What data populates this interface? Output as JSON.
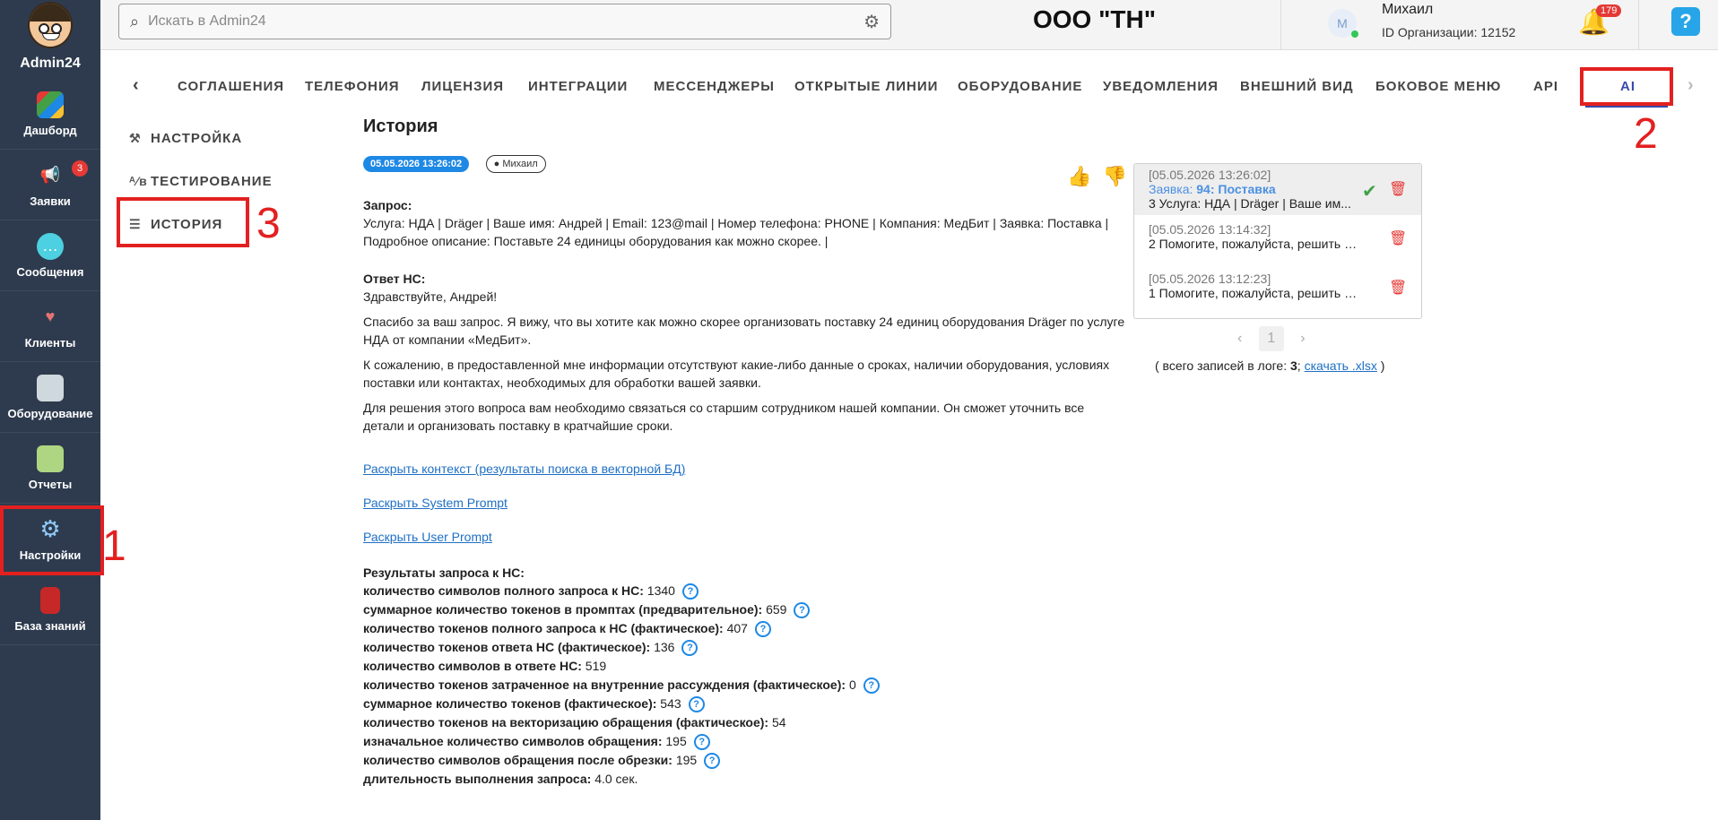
{
  "sidebar": {
    "brand": "Admin24",
    "items": [
      {
        "label": "Дашборд",
        "icon": "dashboard-icon"
      },
      {
        "label": "Заявки",
        "icon": "megaphone-icon",
        "badge": "3"
      },
      {
        "label": "Сообщения",
        "icon": "chat-icon"
      },
      {
        "label": "Клиенты",
        "icon": "clients-icon"
      },
      {
        "label": "Оборудование",
        "icon": "equipment-icon"
      },
      {
        "label": "Отчеты",
        "icon": "reports-icon"
      },
      {
        "label": "Настройки",
        "icon": "gear-icon"
      },
      {
        "label": "База знаний",
        "icon": "knowledge-book-icon"
      }
    ]
  },
  "header": {
    "search_placeholder": "Искать в Admin24",
    "org_title": "ООО \"ТН\"",
    "avatar_letter": "M",
    "user_name": "Михаил",
    "org_id": "ID Организации: 12152",
    "notifications_count": "179",
    "help_label": "?"
  },
  "tabs": [
    "СОГЛАШЕНИЯ",
    "ТЕЛЕФОНИЯ",
    "ЛИЦЕНЗИЯ",
    "ИНТЕГРАЦИИ",
    "МЕССЕНДЖЕРЫ",
    "ОТКРЫТЫЕ ЛИНИИ",
    "ОБОРУДОВАНИЕ",
    "УВЕДОМЛЕНИЯ",
    "ВНЕШНИЙ ВИД",
    "БОКОВОЕ МЕНЮ",
    "API",
    "AI"
  ],
  "subnav": [
    {
      "label": "НАСТРОЙКА",
      "icon": "tools-icon"
    },
    {
      "label": "ТЕСТИРОВАНИЕ",
      "icon": "ab-test-icon"
    },
    {
      "label": "ИСТОРИЯ",
      "icon": "list-icon"
    }
  ],
  "annotations": [
    "1",
    "2",
    "3"
  ],
  "history": {
    "title": "История",
    "date_chip": "05.05.2026 13:26:02",
    "user_chip": "Михаил",
    "request_label": "Запрос:",
    "request_text": "Услуга: НДА | Dräger | Ваше имя: Андрей | Email: 123@mail | Номер телефона: PHONE | Компания: МедБит | Заявка: Поставка | Подробное описание: Поставьте 24 единицы оборудования как можно скорее. |",
    "answer_label": "Ответ НС:",
    "answer_greeting": "Здравствуйте, Андрей!",
    "answer_p1": "Спасибо за ваш запрос. Я вижу, что вы хотите как можно скорее организовать поставку 24 единиц оборудования Dräger по услуге НДА от компании «МедБит».",
    "answer_p2": "К сожалению, в предоставленной мне информации отсутствуют какие-либо данные о сроках, наличии оборудования, условиях поставки или контактах, необходимых для обработки вашей заявки.",
    "answer_p3": "Для решения этого вопроса вам необходимо связаться со старшим сотрудником нашей компании. Он сможет уточнить все детали и организовать поставку в кратчайшие сроки.",
    "link_context": "Раскрыть контекст (результаты поиска в векторной БД)",
    "link_system": "Раскрыть System Prompt",
    "link_user": "Раскрыть User Prompt",
    "results_title": "Результаты запроса к НС:",
    "results": [
      {
        "label": "количество символов полного запроса к НС:",
        "value": "1340",
        "help": true
      },
      {
        "label": "суммарное количество токенов в промптах (предварительное):",
        "value": "659",
        "help": true
      },
      {
        "label": "количество токенов полного запроса к НС (фактическое):",
        "value": "407",
        "help": true
      },
      {
        "label": "количество токенов ответа НС (фактическое):",
        "value": "136",
        "help": true
      },
      {
        "label": "количество символов в ответе НС:",
        "value": "519",
        "help": false
      },
      {
        "label": "количество токенов затраченное на внутренние рассуждения (фактическое):",
        "value": "0",
        "help": true
      },
      {
        "label": "суммарное количество токенов (фактическое):",
        "value": "543",
        "help": true
      },
      {
        "label": "количество токенов на векторизацию обращения (фактическое):",
        "value": "54",
        "help": false
      },
      {
        "label": "изначальное количество символов обращения:",
        "value": "195",
        "help": true
      },
      {
        "label": "количество символов обращения после обрезки:",
        "value": "195",
        "help": true
      },
      {
        "label": "длительность выполнения запроса:",
        "value": "4.0 сек.",
        "help": false
      }
    ]
  },
  "log": {
    "items": [
      {
        "date": "[05.05.2026 13:26:02]",
        "req_prefix": "Заявка: ",
        "req_bold": "94: Поставка",
        "text": "3 Услуга: НДА | Dräger | Ваше им..."
      },
      {
        "date": "[05.05.2026 13:14:32]",
        "text": "2 Помогите, пожалуйста, решить мо..."
      },
      {
        "date": "[05.05.2026 13:12:23]",
        "text": "1 Помогите, пожалуйста, решить мо..."
      }
    ],
    "page": "1",
    "summary_prefix": "( всего записей в логе: ",
    "summary_count": "3",
    "summary_sep": "; ",
    "download_link": "скачать .xlsx",
    "summary_suffix": " )"
  }
}
